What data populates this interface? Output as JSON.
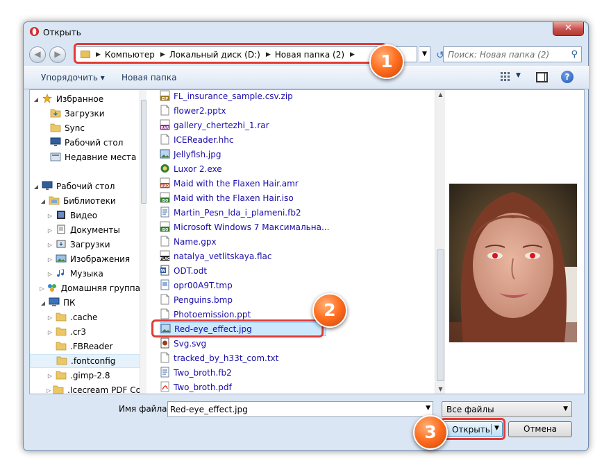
{
  "window": {
    "title": "Открыть"
  },
  "address": {
    "crumbs": [
      "Компьютер",
      "Локальный диск (D:)",
      "Новая папка (2)"
    ],
    "search_placeholder": "Поиск: Новая папка (2)"
  },
  "toolbar": {
    "organize_label": "Упорядочить ▾",
    "new_folder_label": "Новая папка"
  },
  "tree": {
    "items": [
      {
        "label": "Избранное",
        "icon": "star-icon",
        "arrow": "◢"
      },
      {
        "label": "Загрузки",
        "icon": "downloads-folder-icon",
        "arrow": ""
      },
      {
        "label": "Sync",
        "icon": "folder-icon",
        "arrow": ""
      },
      {
        "label": "Рабочий стол",
        "icon": "desktop-icon",
        "arrow": ""
      },
      {
        "label": "Недавние места",
        "icon": "recent-places-icon",
        "arrow": ""
      },
      {
        "label": "Рабочий стол",
        "icon": "desktop-icon",
        "arrow": "◢"
      },
      {
        "label": "Библиотеки",
        "icon": "libraries-icon",
        "arrow": "◢"
      },
      {
        "label": "Видео",
        "icon": "video-library-icon",
        "arrow": "▷"
      },
      {
        "label": "Документы",
        "icon": "documents-library-icon",
        "arrow": "▷"
      },
      {
        "label": "Загрузки",
        "icon": "downloads-library-icon",
        "arrow": "▷"
      },
      {
        "label": "Изображения",
        "icon": "pictures-library-icon",
        "arrow": "▷"
      },
      {
        "label": "Музыка",
        "icon": "music-library-icon",
        "arrow": "▷"
      },
      {
        "label": "Домашняя группа",
        "icon": "homegroup-icon",
        "arrow": "▷"
      },
      {
        "label": "ПК",
        "icon": "computer-icon",
        "arrow": "◢"
      },
      {
        "label": ".cache",
        "icon": "folder-icon",
        "arrow": "▷"
      },
      {
        "label": ".cr3",
        "icon": "folder-icon",
        "arrow": "▷"
      },
      {
        "label": ".FBReader",
        "icon": "folder-icon",
        "arrow": ""
      },
      {
        "label": ".fontconfig",
        "icon": "folder-icon",
        "arrow": ""
      },
      {
        "label": ".gimp-2.8",
        "icon": "folder-icon",
        "arrow": "▷"
      },
      {
        "label": ".Icecream PDF Co",
        "icon": "folder-icon",
        "arrow": "▷"
      }
    ]
  },
  "files": {
    "items": [
      {
        "name": "FL_insurance_sample.csv.zip",
        "icon": "zip-file-icon"
      },
      {
        "name": "flower2.pptx",
        "icon": "document-file-icon"
      },
      {
        "name": "gallery_chertezhi_1.rar",
        "icon": "rar-file-icon"
      },
      {
        "name": "ICEReader.hhc",
        "icon": "document-file-icon"
      },
      {
        "name": "Jellyfish.jpg",
        "icon": "image-file-icon"
      },
      {
        "name": "Luxor 2.exe",
        "icon": "exe-file-icon"
      },
      {
        "name": "Maid with the Flaxen Hair.amr",
        "icon": "audio-file-icon"
      },
      {
        "name": "Maid with the Flaxen Hair.iso",
        "icon": "iso-file-icon"
      },
      {
        "name": "Martin_Pesn_lda_i_plameni.fb2",
        "icon": "fb2-file-icon"
      },
      {
        "name": "Microsoft Windows 7 Максимальна...",
        "icon": "iso-file-icon"
      },
      {
        "name": "Name.gpx",
        "icon": "document-file-icon"
      },
      {
        "name": "natalya_vetlitskaya.flac",
        "icon": "flac-file-icon"
      },
      {
        "name": "ODT.odt",
        "icon": "word-file-icon"
      },
      {
        "name": "opr00A9T.tmp",
        "icon": "tmp-file-icon"
      },
      {
        "name": "Penguins.bmp",
        "icon": "document-file-icon"
      },
      {
        "name": "Photoemission.ppt",
        "icon": "document-file-icon"
      },
      {
        "name": "Red-eye_effect.jpg",
        "icon": "image-file-icon",
        "selected": true
      },
      {
        "name": "Svg.svg",
        "icon": "svg-file-icon"
      },
      {
        "name": "tracked_by_h33t_com.txt",
        "icon": "document-file-icon"
      },
      {
        "name": "Two_broth.fb2",
        "icon": "fb2-file-icon"
      },
      {
        "name": "Two_broth.pdf",
        "icon": "pdf-file-icon"
      }
    ]
  },
  "footer": {
    "filename_label": "Имя файла:",
    "filename_value": "Red-eye_effect.jpg",
    "filter_value": "Все файлы",
    "open_label": "Открыть",
    "cancel_label": "Отмена"
  },
  "callouts": {
    "step1": "1",
    "step2": "2",
    "step3": "3"
  },
  "colors": {
    "callout": "#ff6e1f",
    "highlight": "#e23b34",
    "selection": "#cce8ff"
  }
}
